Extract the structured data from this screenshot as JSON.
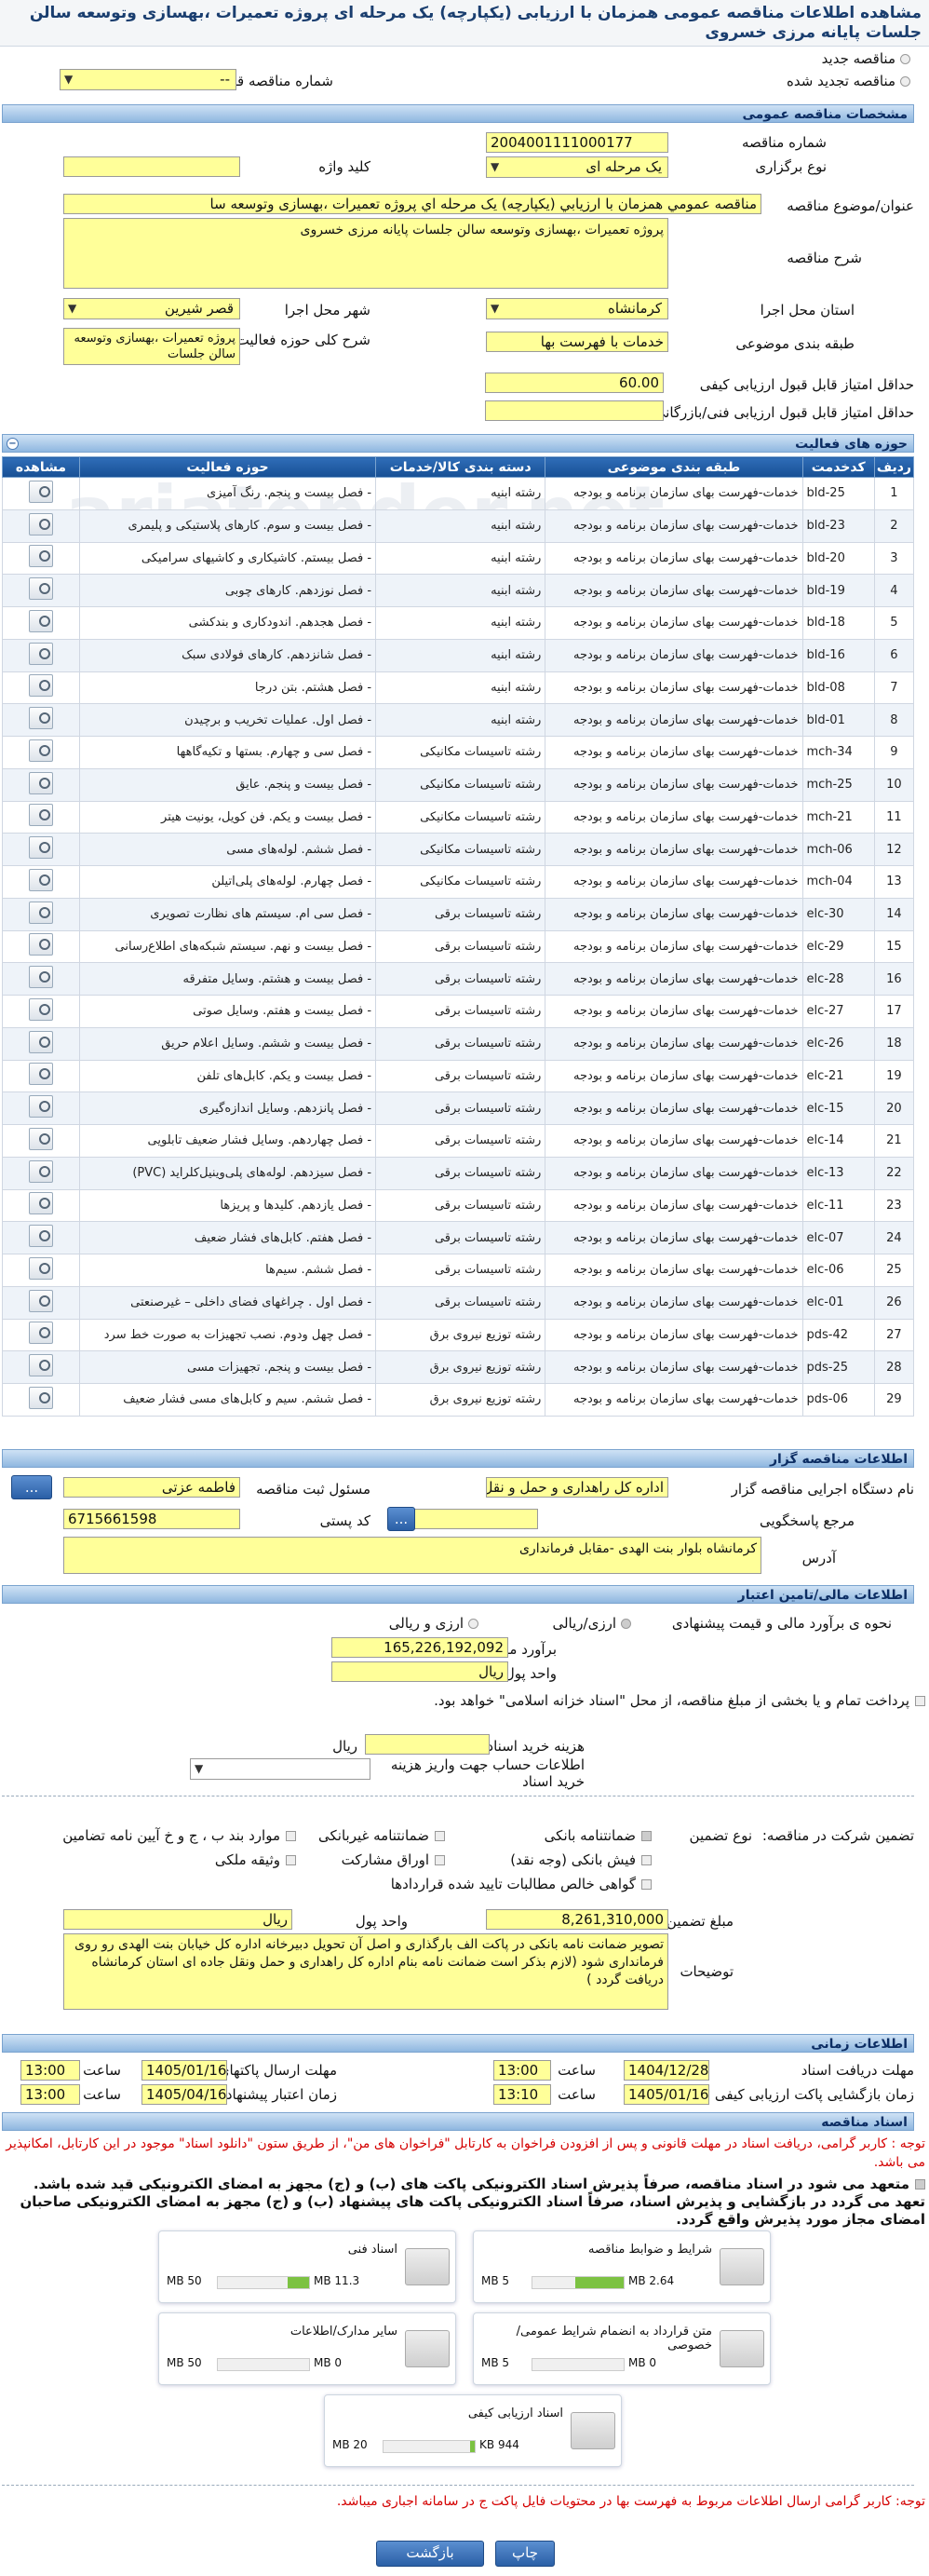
{
  "title": "مشاهده اطلاعات مناقصه عمومی همزمان با ارزیابی (یکپارچه) یک مرحله ای پروژه تعمیرات ،بهسازی وتوسعه سالن جلسات پایانه مرزی خسروی",
  "top": {
    "new_tender": "مناقصه جدید",
    "renewed_tender": "مناقصه تجدید شده",
    "prev_number_label": "شماره مناقصه قبلی",
    "prev_number_value": "--"
  },
  "general": {
    "section": "مشخصات مناقصه عمومی",
    "number_label": "شماره مناقصه",
    "number": "2004001111000177",
    "type_label": "نوع برگزاری",
    "type": "یک مرحله ای",
    "keyword_label": "کلید واژه",
    "keyword": "",
    "subject_label": "عنوان/موضوع مناقصه",
    "subject": "مناقصه عمومي همزمان با ارزيابي (يكپارچه) يک مرحله اي پروژه تعميرات ،بهسازی  وتوسعه سا",
    "desc_label": "شرح مناقصه",
    "desc": "پروژه تعميرات ،بهسازی  وتوسعه سالن جلسات پايانه مرزی خسروی",
    "province_label": "استان محل اجرا",
    "province": "كرمانشاه",
    "city_label": "شهر محل اجرا",
    "city": "قصر شيرين",
    "category_label": "طبقه بندی موضوعی",
    "category": "خدمات با فهرست بها",
    "scope_label": "شرح کلی حوزه فعالیت",
    "scope": "پروژه تعميرات ،بهسازی وتوسعه سالن جلسات",
    "min_quality_label": "حداقل امتیاز قابل قبول ارزیابی کیفی",
    "min_quality": "60.00",
    "min_tech_label": "حداقل امتیاز قابل قبول ارزیابی فنی/بازرگانی",
    "min_tech": ""
  },
  "activities": {
    "section": "حوزه های فعالیت",
    "headers": {
      "row": "ردیف",
      "code": "کدخدمت",
      "category": "طبقه بندی موضوعی",
      "group": "دسته بندی کالا/خدمات",
      "field": "حوزه فعالیت",
      "view": "مشاهده"
    },
    "rows": [
      {
        "n": "1",
        "code": "bld-25",
        "cat": "خدمات-فهرست بهای سازمان برنامه و بودجه",
        "grp": "رشته ابنیه",
        "fld": "- فصل بیست و پنجم. رنگ آمیزی"
      },
      {
        "n": "2",
        "code": "bld-23",
        "cat": "خدمات-فهرست بهای سازمان برنامه و بودجه",
        "grp": "رشته ابنیه",
        "fld": "- فصل بیست و سوم. کارهای پلاستیکی و پلیمری"
      },
      {
        "n": "3",
        "code": "bld-20",
        "cat": "خدمات-فهرست بهای سازمان برنامه و بودجه",
        "grp": "رشته ابنیه",
        "fld": "- فصل بیستم. کاشیکاری و کاشیهای سرامیکی"
      },
      {
        "n": "4",
        "code": "bld-19",
        "cat": "خدمات-فهرست بهای سازمان برنامه و بودجه",
        "grp": "رشته ابنیه",
        "fld": "- فصل نوزدهم. کارهای چوبی"
      },
      {
        "n": "5",
        "code": "bld-18",
        "cat": "خدمات-فهرست بهای سازمان برنامه و بودجه",
        "grp": "رشته ابنیه",
        "fld": "- فصل هجدهم. اندودکاری و بندکشی"
      },
      {
        "n": "6",
        "code": "bld-16",
        "cat": "خدمات-فهرست بهای سازمان برنامه و بودجه",
        "grp": "رشته ابنیه",
        "fld": "- فصل شانزدهم. کارهای فولادی سبک"
      },
      {
        "n": "7",
        "code": "bld-08",
        "cat": "خدمات-فهرست بهای سازمان برنامه و بودجه",
        "grp": "رشته ابنیه",
        "fld": "- فصل هشتم. بتن درجا"
      },
      {
        "n": "8",
        "code": "bld-01",
        "cat": "خدمات-فهرست بهای سازمان برنامه و بودجه",
        "grp": "رشته ابنیه",
        "fld": "- فصل اول. عملیات تخریب و برچیدن"
      },
      {
        "n": "9",
        "code": "mch-34",
        "cat": "خدمات-فهرست بهای سازمان برنامه و بودجه",
        "grp": "رشته تاسیسات مکانیکی",
        "fld": "- فصل سی و چهارم. بستها و تکیه‌گاهها"
      },
      {
        "n": "10",
        "code": "mch-25",
        "cat": "خدمات-فهرست بهای سازمان برنامه و بودجه",
        "grp": "رشته تاسیسات مکانیکی",
        "fld": "- فصل بیست و پنجم. عایق"
      },
      {
        "n": "11",
        "code": "mch-21",
        "cat": "خدمات-فهرست بهای سازمان برنامه و بودجه",
        "grp": "رشته تاسیسات مکانیکی",
        "fld": "- فصل بیست و یکم. فن کویل، یونیت هیتر"
      },
      {
        "n": "12",
        "code": "mch-06",
        "cat": "خدمات-فهرست بهای سازمان برنامه و بودجه",
        "grp": "رشته تاسیسات مکانیکی",
        "fld": "- فصل ششم. لوله‌های مسی"
      },
      {
        "n": "13",
        "code": "mch-04",
        "cat": "خدمات-فهرست بهای سازمان برنامه و بودجه",
        "grp": "رشته تاسیسات مکانیکی",
        "fld": "- فصل چهارم. لوله‌های پلی‌اتیلن"
      },
      {
        "n": "14",
        "code": "elc-30",
        "cat": "خدمات-فهرست بهای سازمان برنامه و بودجه",
        "grp": "رشته تاسیسات برقی",
        "fld": "- فصل سی ام. سیستم های نظارت تصویری"
      },
      {
        "n": "15",
        "code": "elc-29",
        "cat": "خدمات-فهرست بهای سازمان برنامه و بودجه",
        "grp": "رشته تاسیسات برقی",
        "fld": "- فصل بیست و نهم. سیستم شبکه‌های اطلاع‌رسانی"
      },
      {
        "n": "16",
        "code": "elc-28",
        "cat": "خدمات-فهرست بهای سازمان برنامه و بودجه",
        "grp": "رشته تاسیسات برقی",
        "fld": "- فصل بیست و هشتم. وسایل متفرقه"
      },
      {
        "n": "17",
        "code": "elc-27",
        "cat": "خدمات-فهرست بهای سازمان برنامه و بودجه",
        "grp": "رشته تاسیسات برقی",
        "fld": "- فصل بیست و هفتم. وسایل صوتی"
      },
      {
        "n": "18",
        "code": "elc-26",
        "cat": "خدمات-فهرست بهای سازمان برنامه و بودجه",
        "grp": "رشته تاسیسات برقی",
        "fld": "- فصل بیست و ششم. وسایل اعلام حریق"
      },
      {
        "n": "19",
        "code": "elc-21",
        "cat": "خدمات-فهرست بهای سازمان برنامه و بودجه",
        "grp": "رشته تاسیسات برقی",
        "fld": "- فصل بیست و یکم. کابل‌های تلفن"
      },
      {
        "n": "20",
        "code": "elc-15",
        "cat": "خدمات-فهرست بهای سازمان برنامه و بودجه",
        "grp": "رشته تاسیسات برقی",
        "fld": "- فصل پانزدهم. وسایل اندازه‌گیری"
      },
      {
        "n": "21",
        "code": "elc-14",
        "cat": "خدمات-فهرست بهای سازمان برنامه و بودجه",
        "grp": "رشته تاسیسات برقی",
        "fld": "- فصل چهاردهم. وسایل فشار ضعیف تابلویی"
      },
      {
        "n": "22",
        "code": "elc-13",
        "cat": "خدمات-فهرست بهای سازمان برنامه و بودجه",
        "grp": "رشته تاسیسات برقی",
        "fld": "- فصل سیزدهم. لوله‌های پلی‌وینیل‌کلراید (PVC)"
      },
      {
        "n": "23",
        "code": "elc-11",
        "cat": "خدمات-فهرست بهای سازمان برنامه و بودجه",
        "grp": "رشته تاسیسات برقی",
        "fld": "- فصل یازدهم. کلیدها و پریزها"
      },
      {
        "n": "24",
        "code": "elc-07",
        "cat": "خدمات-فهرست بهای سازمان برنامه و بودجه",
        "grp": "رشته تاسیسات برقی",
        "fld": "- فصل هفتم. کابل‌های فشار ضعیف"
      },
      {
        "n": "25",
        "code": "elc-06",
        "cat": "خدمات-فهرست بهای سازمان برنامه و بودجه",
        "grp": "رشته تاسیسات برقی",
        "fld": "- فصل ششم. سیم‌ها"
      },
      {
        "n": "26",
        "code": "elc-01",
        "cat": "خدمات-فهرست بهای سازمان برنامه و بودجه",
        "grp": "رشته تاسیسات برقی",
        "fld": "- فصل اول . چراغهای فضای داخلی – غیرصنعتی"
      },
      {
        "n": "27",
        "code": "pds-42",
        "cat": "خدمات-فهرست بهای سازمان برنامه و بودجه",
        "grp": "رشته توزیع نیروی برق",
        "fld": "- فصل چهل ودوم. نصب تجهیزات به صورت خط سرد"
      },
      {
        "n": "28",
        "code": "pds-25",
        "cat": "خدمات-فهرست بهای سازمان برنامه و بودجه",
        "grp": "رشته توزیع نیروی برق",
        "fld": "- فصل بیست و پنجم. تجهیزات مسی"
      },
      {
        "n": "29",
        "code": "pds-06",
        "cat": "خدمات-فهرست بهای سازمان برنامه و بودجه",
        "grp": "رشته توزیع نیروی برق",
        "fld": "- فصل ششم. سیم و کابل‌های مسی فشار ضعیف"
      }
    ]
  },
  "organizer": {
    "section": "اطلاعات مناقصه گزار",
    "org_label": "نام دستگاه اجرایی مناقصه گزار",
    "org": "اداره كل راهداری و حمل و نقل",
    "resp_label": "مسئول ثبت مناقصه",
    "resp": "فاطمه  عزتی",
    "ref_label": "مرجع پاسخگویی",
    "ref": "",
    "postal_label": "کد پستی",
    "postal": "6715661598",
    "addr_label": "آدرس",
    "addr": "كرمانشاه بلوار بنت الهدی -مقابل فرمانداری"
  },
  "finance": {
    "section": "اطلاعات مالی/تامین اعتبار",
    "offer_label": "نحوه ی برآورد مالی و قیمت پیشنهادی",
    "rial": "ارزی/ریالی",
    "both": "ارزی و ریالی",
    "estimate_label": "برآورد مالی",
    "estimate": "165,226,192,092",
    "unit_label": "واحد پول",
    "unit": "ريال",
    "treasury": "پرداخت تمام و یا بخشی از مبلغ مناقصه، از محل \"اسناد خزانه اسلامی\" خواهد بود.",
    "doc_cost_label": "هزینه خرید اسناد",
    "doc_cost": "",
    "doc_cost_unit": "ریال",
    "acct_label": "اطلاعات حساب جهت واریز هزینه خرید اسناد"
  },
  "guarantee": {
    "part_label": "تضمین شرکت در مناقصه:",
    "type_label": "نوع تضمین",
    "opts": [
      "ضمانتنامه بانکی",
      "ضمانتنامه غیربانکی",
      "موارد بند ب ، ج و خ آیین نامه تضامین",
      "فیش بانکی (وجه نقد)",
      "اوراق مشارکت",
      "وثیقه ملکی",
      "گواهی خالص مطالبات تایید شده قراردادها"
    ],
    "amount_label": "مبلغ تضمین",
    "amount": "8,261,310,000",
    "unit_label": "واحد پول",
    "unit": "ريال",
    "expl_label": "توضیحات",
    "expl": "تصوير ضمانت نامه بانكی در پاكت الف بارگذاری و اصل آن تحويل دبيرخانه اداره كل خيابان بنت الهدی رو روی فرمانداری شود  (لازم بذكر است ضمانت نامه بنام اداره كل راهداری و حمل ونقل جاده ای استان كرمانشاه دريافت گردد )"
  },
  "timing": {
    "section": "اطلاعات زمانی",
    "recv_label": "مهلت دریافت اسناد",
    "recv_date": "1404/12/28",
    "recv_time": "13:00",
    "send_label": "مهلت ارسال پاکتهای پیشنهاد",
    "send_date": "1405/01/16",
    "send_time": "13:00",
    "open_label": "زمان بازگشایی پاکت ارزیابی کیفی",
    "open_date": "1405/01/16",
    "open_time": "13:10",
    "valid_label": "زمان اعتبار پیشنهاد",
    "valid_date": "1405/04/16",
    "valid_time": "13:00",
    "time_word": "ساعت"
  },
  "docs": {
    "section": "اسناد مناقصه",
    "note1": "توجه : کاربر گرامی، دریافت اسناد در مهلت قانونی و پس از افزودن فراخوان به کارتابل \"فراخوان های من\"، از طریق ستون \"دانلود اسناد\" موجود در این کارتابل، امکانپذیر می باشد.",
    "note2": "متعهد می شود در اسناد مناقصه، صرفاً پذیرش اسناد الکترونیکی پاکت های (ب) و (ج) مجهز به امضای الکترونیکی قید شده باشد. تعهد می گردد در بازگشایی و پذیرش اسناد، صرفاً اسناد الکترونیکی پاکت های پیشنهاد (ب) و (ج) مجهز به امضای الکترونیکی صاحبان امضای مجاز مورد پذیرش واقع گردد.",
    "files": [
      {
        "name": "شرایط و ضوابط مناقصه",
        "used": "2.64 MB",
        "max": "5 MB",
        "pct": 53
      },
      {
        "name": "اسناد فنی",
        "used": "11.3 MB",
        "max": "50 MB",
        "pct": 23
      },
      {
        "name": "متن قرارداد به انضمام شرایط عمومی/خصوصی",
        "used": "0 MB",
        "max": "5 MB",
        "pct": 0
      },
      {
        "name": "سایر مدارک/اطلاعات",
        "used": "0 MB",
        "max": "50 MB",
        "pct": 0
      },
      {
        "name": "اسناد ارزیابی کیفی",
        "used": "944 KB",
        "max": "20 MB",
        "pct": 5
      }
    ],
    "note3": "توجه: کاربر گرامی ارسال اطلاعات مربوط به فهرست بها در محتویات فایل پاکت ج در سامانه اجباری میباشد."
  },
  "buttons": {
    "print": "چاپ",
    "back": "بازگشت",
    "dots": "..."
  },
  "watermark": "ariatender.net"
}
